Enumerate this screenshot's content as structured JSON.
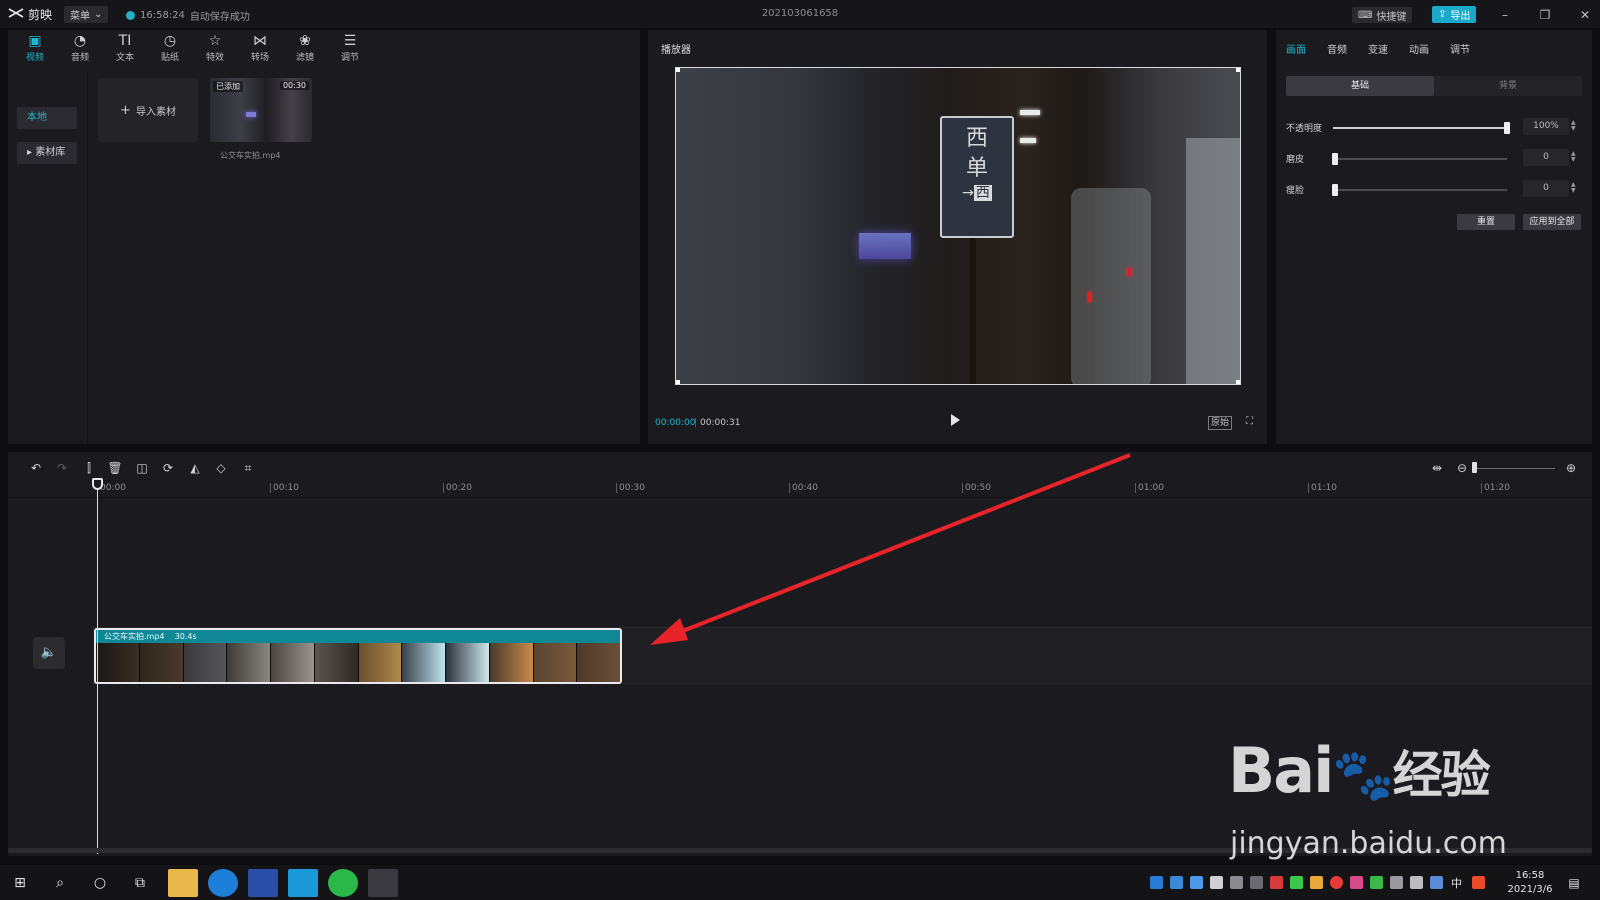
{
  "titlebar": {
    "app_name": "剪映",
    "menu_label": "菜单",
    "save_time": "16:58:24",
    "save_status": "自动保存成功",
    "project_name": "202103061658",
    "shortcut_label": "快捷键",
    "export_label": "导出"
  },
  "media_toolbar": [
    {
      "label": "视频",
      "icon": "video-icon"
    },
    {
      "label": "音频",
      "icon": "audio-icon"
    },
    {
      "label": "文本",
      "icon": "text-icon"
    },
    {
      "label": "贴纸",
      "icon": "sticker-icon"
    },
    {
      "label": "特效",
      "icon": "effects-icon"
    },
    {
      "label": "转场",
      "icon": "transition-icon"
    },
    {
      "label": "滤镜",
      "icon": "filter-icon"
    },
    {
      "label": "调节",
      "icon": "adjust-icon"
    }
  ],
  "media_sidebar": {
    "local": "本地",
    "library": "素材库"
  },
  "media": {
    "import_label": "导入素材",
    "clip_badge": "已添加",
    "clip_duration": "00:30",
    "clip_filename": "公交车实拍.mp4"
  },
  "player": {
    "title": "播放器",
    "current_time": "00:00:00",
    "total_time": "00:00:31",
    "ratio_label": "原始",
    "sign_chars": [
      "西",
      "单",
      "西"
    ]
  },
  "properties": {
    "tabs": [
      "画面",
      "音频",
      "变速",
      "动画",
      "调节"
    ],
    "seg_basic": "基础",
    "seg_background": "背景",
    "opacity_label": "不透明度",
    "opacity_value": "100%",
    "opacity_level": 1.0,
    "smooth_label": "磨皮",
    "smooth_value": "0",
    "slim_label": "瘦脸",
    "slim_value": "0",
    "reset_label": "重置",
    "apply_all_label": "应用到全部"
  },
  "timeline": {
    "ticks": [
      "00:00",
      "00:10",
      "00:20",
      "00:30",
      "00:40",
      "00:50",
      "01:00",
      "01:10",
      "01:20"
    ],
    "clip_name": "公交车实拍.mp4",
    "clip_length": "30.4s"
  },
  "watermark": {
    "brand": "Bai",
    "brand_cn": "经验",
    "url": "jingyan.baidu.com"
  },
  "taskbar": {
    "time": "16:58",
    "date": "2021/3/6",
    "ime": "中"
  },
  "colors": {
    "accent": "#1fb5cf",
    "export": "#1aa9c9",
    "clip": "#0f8794",
    "arrow": "#e8242a"
  }
}
